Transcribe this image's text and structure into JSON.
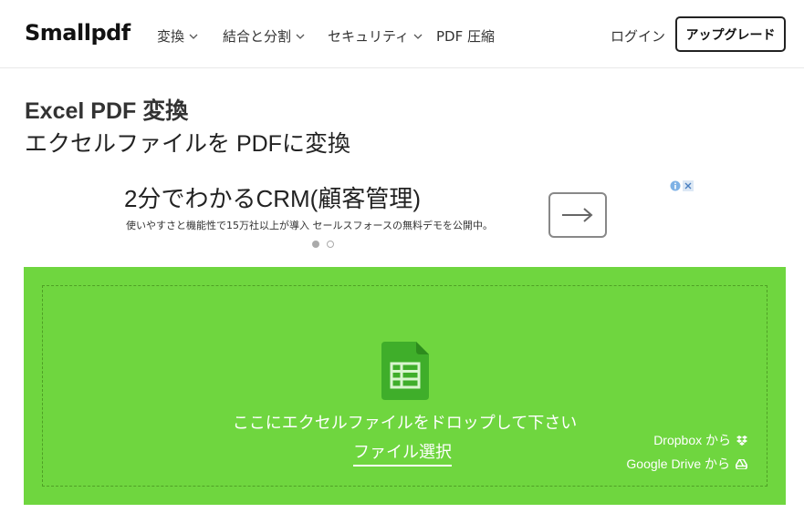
{
  "header": {
    "logo": "Smallpdf",
    "nav": [
      {
        "label": "変換",
        "dropdown": true
      },
      {
        "label": "結合と分割",
        "dropdown": true
      },
      {
        "label": "セキュリティ",
        "dropdown": true
      },
      {
        "label": "PDF 圧縮",
        "dropdown": false
      }
    ],
    "login": "ログイン",
    "upgrade": "アップグレード"
  },
  "page": {
    "title": "Excel PDF 変換",
    "subtitle": "エクセルファイルを PDFに変換"
  },
  "ad": {
    "headline": "2分でわかるCRM(顧客管理)",
    "description": "使いやすさと機能性で15万社以上が導入 セールスフォースの無料デモを公開中。",
    "arrow_icon": "arrow-right-icon",
    "carousel_active": 1,
    "carousel_count": 2
  },
  "dropzone": {
    "background": "#6fd63f",
    "icon": "spreadsheet-icon",
    "prompt": "ここにエクセルファイルをドロップして下さい",
    "choose_label": "ファイル選択",
    "sources": [
      {
        "label": "Dropbox から",
        "icon": "dropbox-icon"
      },
      {
        "label": "Google Drive から",
        "icon": "google-drive-icon"
      }
    ]
  }
}
